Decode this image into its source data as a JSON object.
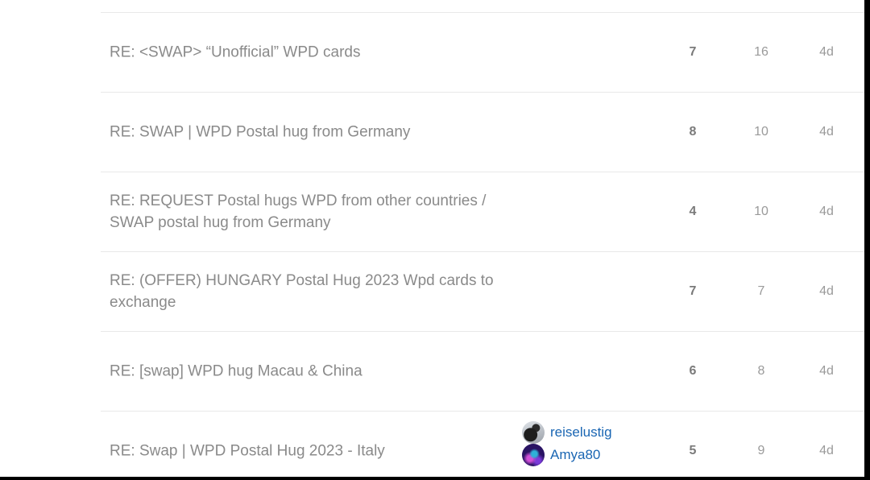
{
  "topics": [
    {
      "title": "RE: <SWAP> “Unofficial” WPD cards",
      "replies": "7",
      "views": "16",
      "activity": "4d"
    },
    {
      "title": "RE: SWAP | WPD Postal hug from Germany",
      "replies": "8",
      "views": "10",
      "activity": "4d"
    },
    {
      "title": "RE: REQUEST Postal hugs WPD from other countries / SWAP postal hug from Germany",
      "replies": "4",
      "views": "10",
      "activity": "4d"
    },
    {
      "title": "RE: (OFFER) HUNGARY Postal Hug 2023 Wpd cards to exchange",
      "replies": "7",
      "views": "7",
      "activity": "4d"
    },
    {
      "title": "RE: [swap] WPD hug Macau & China",
      "replies": "6",
      "views": "8",
      "activity": "4d"
    },
    {
      "title": "RE: Swap | WPD Postal Hug 2023 - Italy",
      "replies": "5",
      "views": "9",
      "activity": "4d",
      "posters": [
        {
          "name": "reiselustig",
          "avatar_icon": "bird-avatar-icon"
        },
        {
          "name": "Amya80",
          "avatar_icon": "galaxy-avatar-icon"
        }
      ]
    }
  ],
  "colors": {
    "title": "#8a8a8a",
    "link": "#1a66b3",
    "divider": "#e9e9e9",
    "frame": "#000000"
  }
}
